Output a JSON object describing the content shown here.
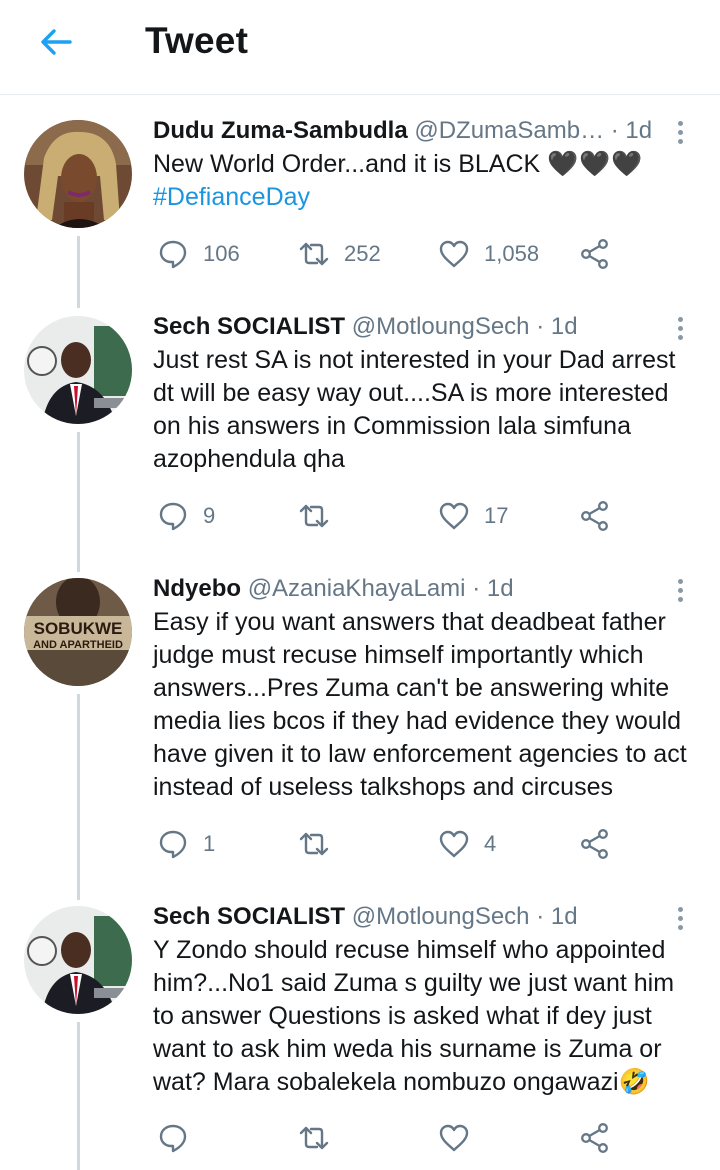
{
  "header": {
    "title": "Tweet",
    "back_icon": "arrow-left-icon",
    "accent": "#1da1f2"
  },
  "tweets": [
    {
      "name": "Dudu Zuma-Sambudla",
      "handle": "@DZumaSamb…",
      "time": "· 1d",
      "text": "New World Order...and it is BLACK",
      "hearts": "🖤🖤🖤",
      "hashtag": "#DefianceDay",
      "replies": "106",
      "retweets": "252",
      "likes": "1,058"
    },
    {
      "name": "Sech SOCIALIST",
      "handle": "@MotloungSech",
      "time": "· 1d",
      "text": "Just rest SA is not interested in your Dad arrest dt will be easy way out....SA is more interested on his answers in Commission lala simfuna azophendula qha",
      "replies": "9",
      "retweets": "",
      "likes": "17"
    },
    {
      "name": "Ndyebo",
      "handle": "@AzaniaKhayaLami",
      "time": "· 1d",
      "avatar_text": [
        "SOBUKWE",
        "AND APARTHEID"
      ],
      "text": "Easy if you want answers that deadbeat father judge must recuse himself importantly which answers...Pres Zuma can't be answering white media lies bcos if they had evidence they would have given it to law enforcement agencies to act instead of useless talkshops and circuses",
      "replies": "1",
      "retweets": "",
      "likes": "4"
    },
    {
      "name": "Sech SOCIALIST",
      "handle": "@MotloungSech",
      "time": "· 1d",
      "text": "Y Zondo should recuse himself who appointed him?...No1 said Zuma s guilty we just want him to answer Questions is asked what if dey just want to ask him weda his surname is Zuma or wat? Mara sobalekela nombuzo ongawazi",
      "emoji": "🤣",
      "replies": "",
      "retweets": "",
      "likes": ""
    }
  ]
}
